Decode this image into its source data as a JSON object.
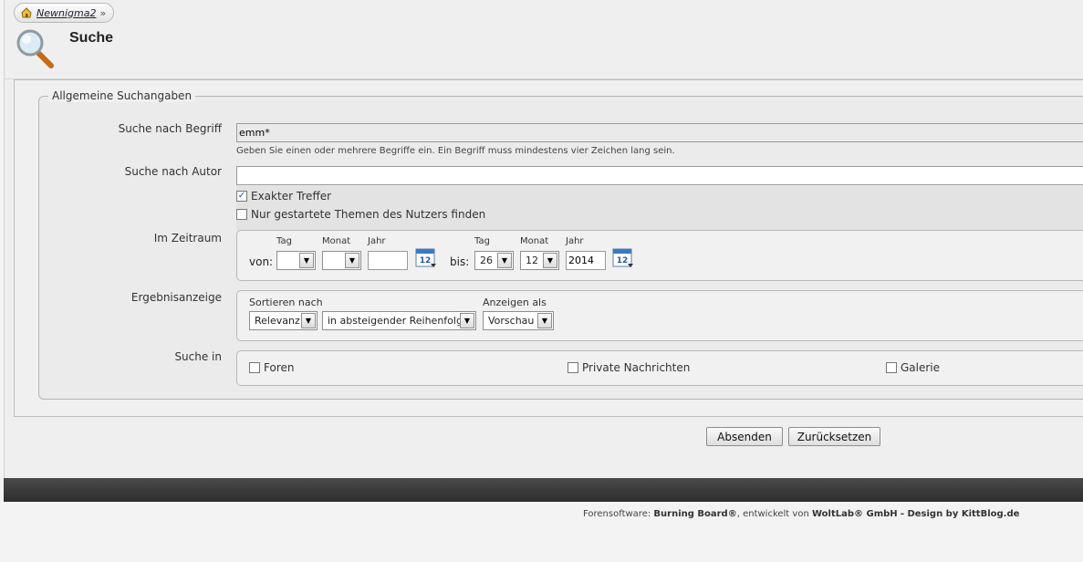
{
  "breadcrumb": {
    "home_label": "Newnigma2",
    "separator": "»"
  },
  "page": {
    "title": "Suche"
  },
  "fieldset": {
    "legend": "Allgemeine Suchangaben"
  },
  "term": {
    "label": "Suche nach Begriff",
    "value": "emm*",
    "hint": "Geben Sie einen oder mehrere Begriffe ein. Ein Begriff muss mindestens vier Zeichen lang sein."
  },
  "author": {
    "label": "Suche nach Autor",
    "value": "",
    "exact_label": "Exakter Treffer",
    "exact_checked": true,
    "started_label": "Nur gestartete Themen des Nutzers finden",
    "started_checked": false
  },
  "period": {
    "label": "Im Zeitraum",
    "from_label": "von:",
    "to_label": "bis:",
    "day_label": "Tag",
    "month_label": "Monat",
    "year_label": "Jahr",
    "from_day": "",
    "from_month": "",
    "from_year": "",
    "to_day": "26",
    "to_month": "12",
    "to_year": "2014"
  },
  "results": {
    "label": "Ergebnisanzeige",
    "sort_label": "Sortieren nach",
    "sort_value": "Relevanz",
    "order_value": "in absteigender Reihenfolge",
    "display_label": "Anzeigen als",
    "display_value": "Vorschau"
  },
  "search_in": {
    "label": "Suche in",
    "forums": "Foren",
    "private_messages": "Private Nachrichten",
    "gallery": "Galerie"
  },
  "buttons": {
    "submit": "Absenden",
    "reset": "Zurücksetzen"
  },
  "footer": {
    "prefix": "Forensoftware:",
    "product": "Burning Board®",
    "middle": ", entwickelt von",
    "company": "WoltLab® GmbH",
    "design": "- Design by KittBlog.de"
  },
  "colors": {
    "accent_dark_bar": "#3a3a3a",
    "checkbox_mark": "#2a4a8a"
  }
}
